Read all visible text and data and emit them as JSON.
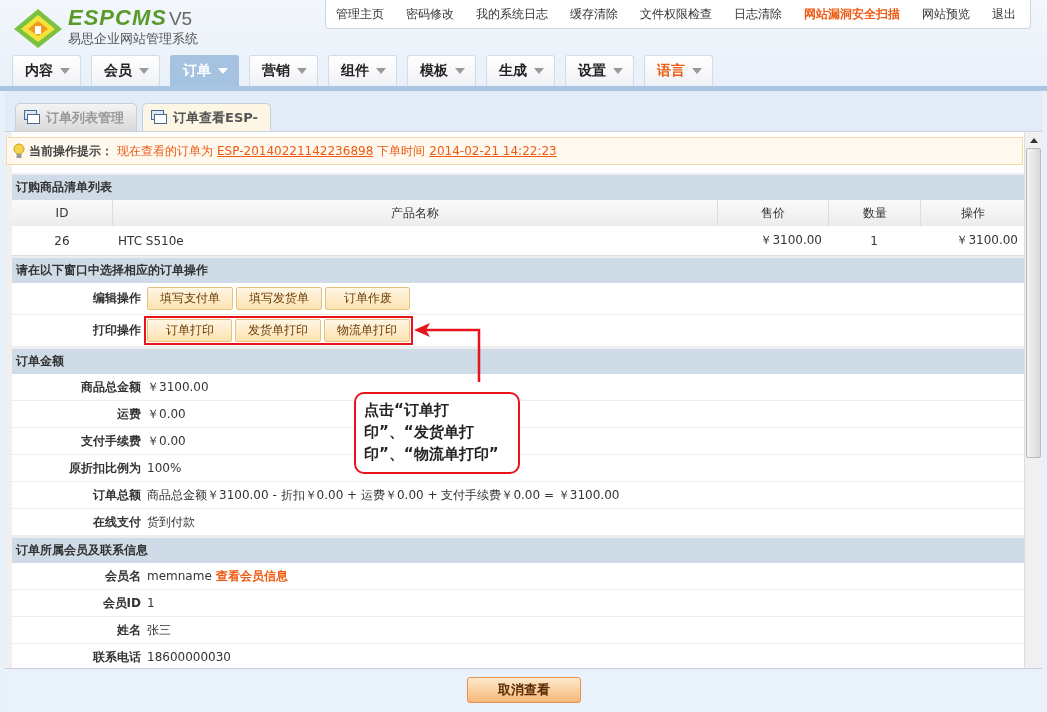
{
  "logo": {
    "name": "ESPCMS",
    "version": "V5",
    "subtitle": "易思企业网站管理系统"
  },
  "top_links": [
    {
      "label": "管理主页",
      "highlight": false
    },
    {
      "label": "密码修改",
      "highlight": false
    },
    {
      "label": "我的系统日志",
      "highlight": false
    },
    {
      "label": "缓存清除",
      "highlight": false
    },
    {
      "label": "文件权限检查",
      "highlight": false
    },
    {
      "label": "日志清除",
      "highlight": false
    },
    {
      "label": "网站漏洞安全扫描",
      "highlight": true
    },
    {
      "label": "网站预览",
      "highlight": false
    },
    {
      "label": "退出",
      "highlight": false
    }
  ],
  "nav": [
    {
      "label": "内容",
      "selected": false,
      "highlight": false
    },
    {
      "label": "会员",
      "selected": false,
      "highlight": false
    },
    {
      "label": "订单",
      "selected": true,
      "highlight": false
    },
    {
      "label": "营销",
      "selected": false,
      "highlight": false
    },
    {
      "label": "组件",
      "selected": false,
      "highlight": false
    },
    {
      "label": "模板",
      "selected": false,
      "highlight": false
    },
    {
      "label": "生成",
      "selected": false,
      "highlight": false
    },
    {
      "label": "设置",
      "selected": false,
      "highlight": false
    },
    {
      "label": "语言",
      "selected": false,
      "highlight": true
    }
  ],
  "tabs": [
    {
      "label": "订单列表管理",
      "selected": false
    },
    {
      "label": "订单查看ESP-",
      "selected": true
    }
  ],
  "hint": {
    "label": "当前操作提示：",
    "text": "现在查看的订单为",
    "order_no": "ESP-20140221142236898",
    "time_label": "下单时间",
    "time": "2014-02-21 14:22:23"
  },
  "products": {
    "title": "订购商品清单列表",
    "columns": [
      "ID",
      "产品名称",
      "售价",
      "数量",
      "操作"
    ],
    "rows": [
      [
        "26",
        "HTC S510e",
        "￥3100.00",
        "1",
        "￥3100.00"
      ]
    ]
  },
  "operations": {
    "title": "请在以下窗口中选择相应的订单操作",
    "groups": [
      {
        "label": "编辑操作",
        "highlighted": false,
        "buttons": [
          "填写支付单",
          "填写发货单",
          "订单作废"
        ]
      },
      {
        "label": "打印操作",
        "highlighted": true,
        "buttons": [
          "订单打印",
          "发货单打印",
          "物流单打印"
        ]
      }
    ]
  },
  "amount": {
    "title": "订单金额",
    "fields": [
      {
        "label": "商品总金额",
        "value": "￥3100.00"
      },
      {
        "label": "运费",
        "value": "￥0.00"
      },
      {
        "label": "支付手续费",
        "value": "￥0.00"
      },
      {
        "label": "原折扣比例为",
        "value": "100%"
      },
      {
        "label": "订单总额",
        "value": "商品总金额￥3100.00 - 折扣￥0.00 + 运费￥0.00 + 支付手续费￥0.00 = ￥3100.00"
      },
      {
        "label": "在线支付",
        "value": "货到付款"
      }
    ]
  },
  "member": {
    "title": "订单所属会员及联系信息",
    "fields": [
      {
        "label": "会员名",
        "value": "memname",
        "link": "查看会员信息"
      },
      {
        "label": "会员ID",
        "value": "1"
      },
      {
        "label": "姓名",
        "value": "张三"
      },
      {
        "label": "联系电话",
        "value": "18600000030"
      }
    ]
  },
  "callout": {
    "text": "点击“订单打印”、“发货单打印”、“物流单打印”"
  },
  "cancel_button": "取消查看"
}
